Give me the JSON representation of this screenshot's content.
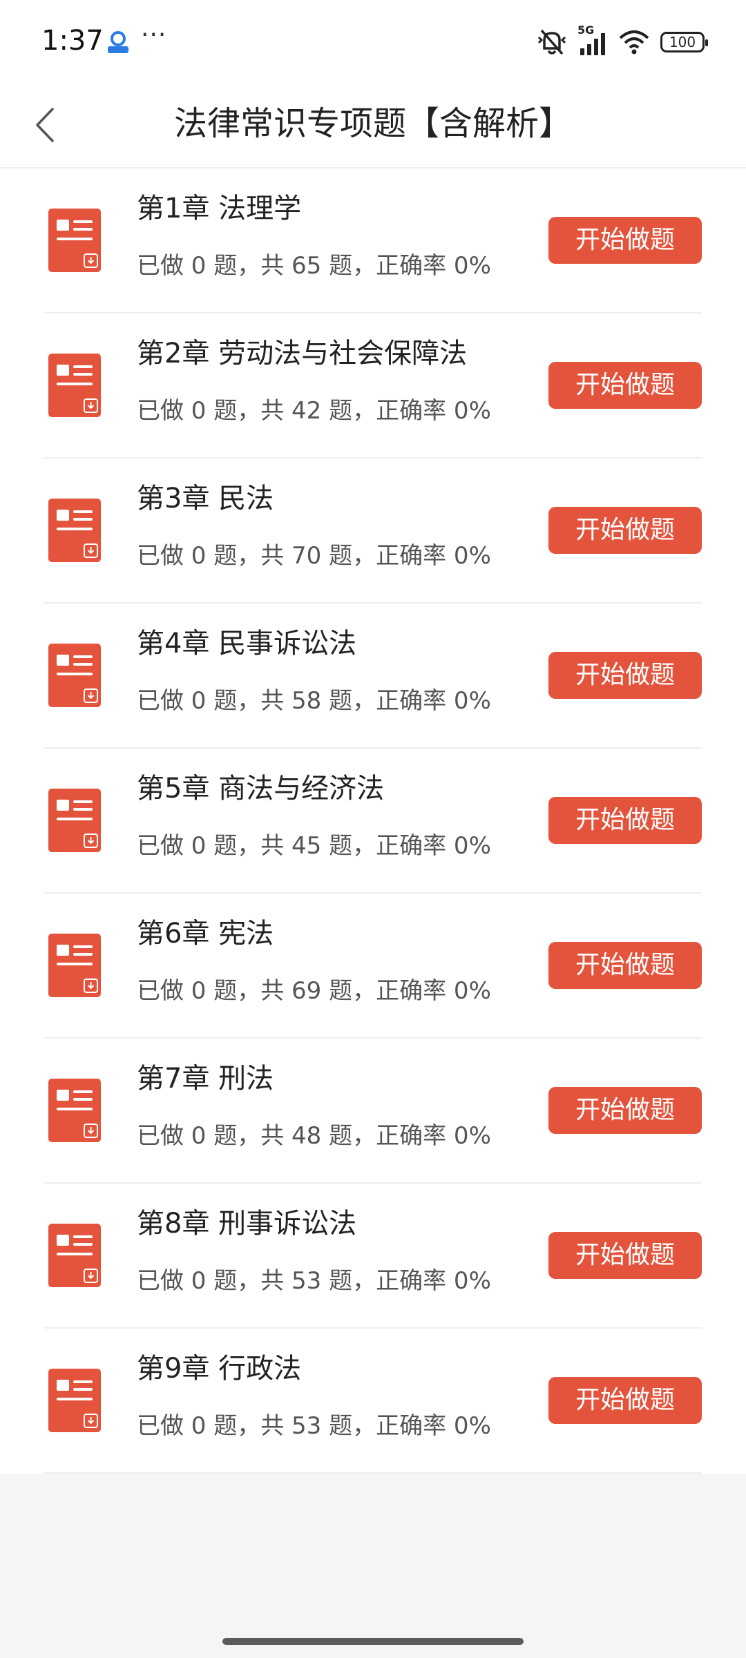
{
  "status_bar": {
    "time": "1:37",
    "dots": "···",
    "network": "5G",
    "battery": "100"
  },
  "header": {
    "title": "法律常识专项题【含解析】"
  },
  "colors": {
    "accent": "#e4533b",
    "divider": "#eeeeee",
    "background": "#f5f5f5"
  },
  "chapters": [
    {
      "title": "第1章  法理学",
      "stats": "已做 0 题，共 65 题，正确率 0%",
      "button": "开始做题"
    },
    {
      "title": "第2章  劳动法与社会保障法",
      "stats": "已做 0 题，共 42 题，正确率 0%",
      "button": "开始做题"
    },
    {
      "title": "第3章  民法",
      "stats": "已做 0 题，共 70 题，正确率 0%",
      "button": "开始做题"
    },
    {
      "title": "第4章  民事诉讼法",
      "stats": "已做 0 题，共 58 题，正确率 0%",
      "button": "开始做题"
    },
    {
      "title": "第5章  商法与经济法",
      "stats": "已做 0 题，共 45 题，正确率 0%",
      "button": "开始做题"
    },
    {
      "title": "第6章  宪法",
      "stats": "已做 0 题，共 69 题，正确率 0%",
      "button": "开始做题"
    },
    {
      "title": "第7章  刑法",
      "stats": "已做 0 题，共 48 题，正确率 0%",
      "button": "开始做题"
    },
    {
      "title": "第8章  刑事诉讼法",
      "stats": "已做 0 题，共 53 题，正确率 0%",
      "button": "开始做题"
    },
    {
      "title": "第9章  行政法",
      "stats": "已做 0 题，共 53 题，正确率 0%",
      "button": "开始做题"
    }
  ]
}
